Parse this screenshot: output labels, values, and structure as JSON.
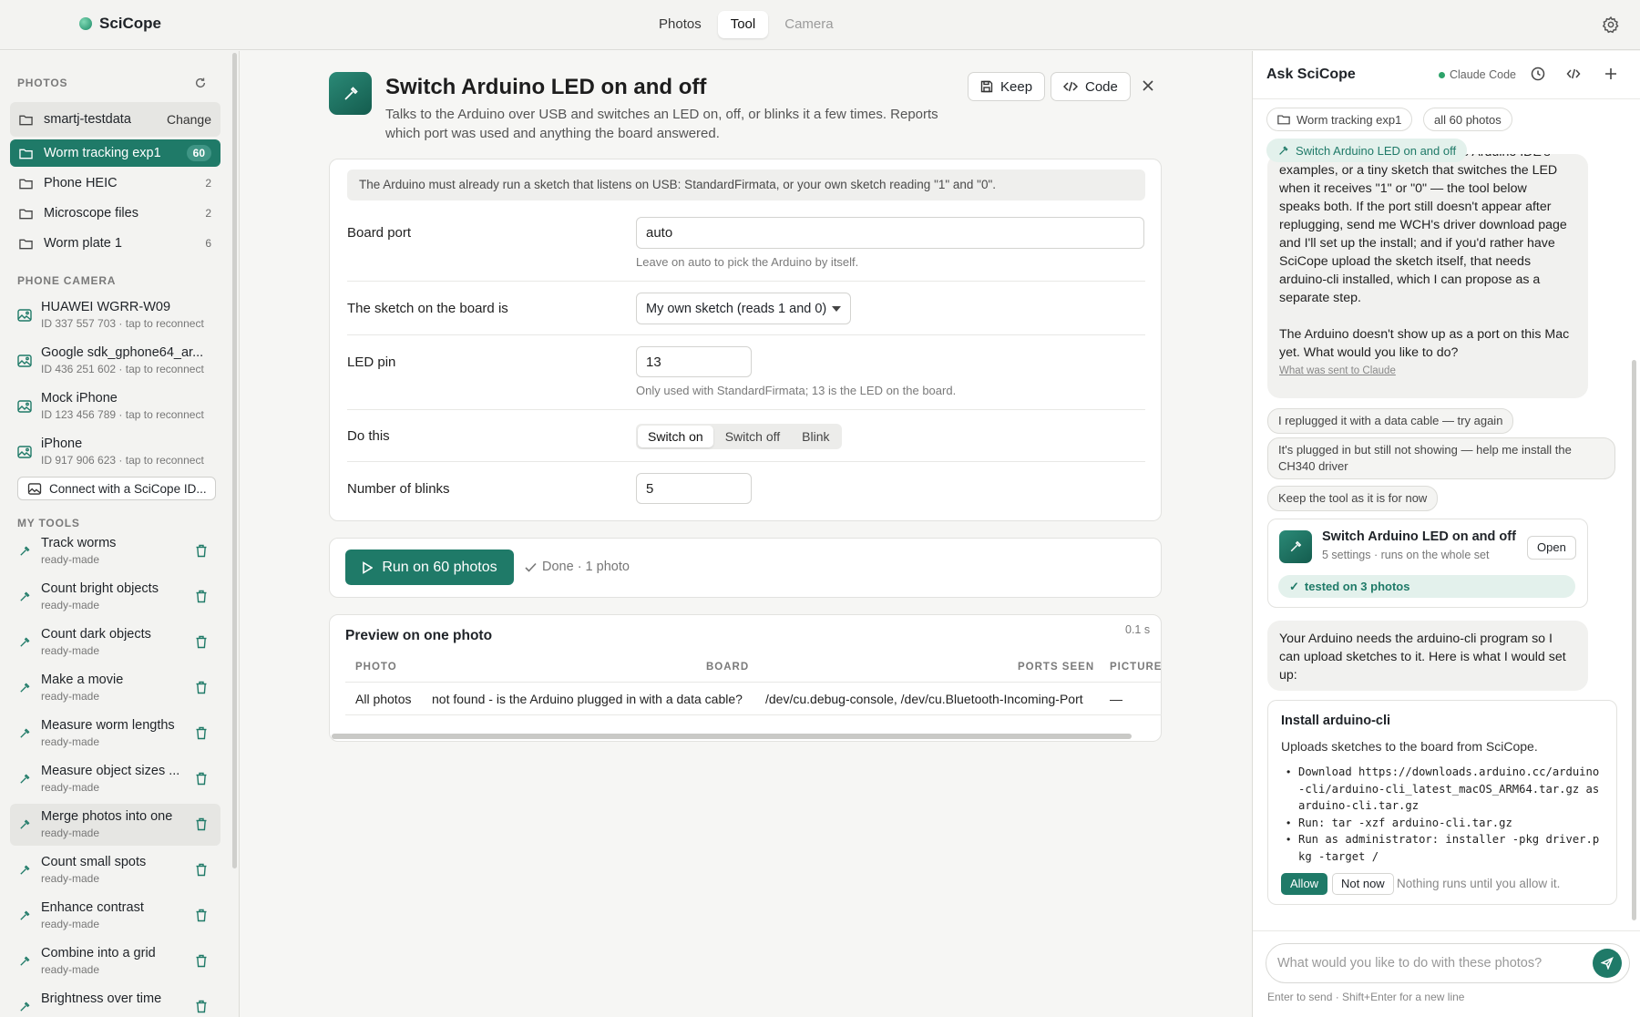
{
  "app": {
    "name": "SciCope"
  },
  "nav": {
    "tabs": [
      {
        "label": "Photos"
      },
      {
        "label": "Tool"
      },
      {
        "label": "Camera"
      }
    ]
  },
  "sidebar": {
    "photos_heading": "PHOTOS",
    "storage": {
      "name": "smartj-testdata",
      "action": "Change"
    },
    "folders": [
      {
        "name": "Worm tracking exp1",
        "count": "60"
      },
      {
        "name": "Phone HEIC",
        "count": "2"
      },
      {
        "name": "Microscope files",
        "count": "2"
      },
      {
        "name": "Worm plate 1",
        "count": "6"
      }
    ],
    "camera_heading": "PHONE CAMERA",
    "cameras": [
      {
        "name": "HUAWEI WGRR-W09",
        "sub": "ID 337 557 703 · tap to reconnect"
      },
      {
        "name": "Google sdk_gphone64_ar...",
        "sub": "ID 436 251 602 · tap to reconnect"
      },
      {
        "name": "Mock iPhone",
        "sub": "ID 123 456 789 · tap to reconnect"
      },
      {
        "name": "iPhone",
        "sub": "ID 917 906 623 · tap to reconnect"
      }
    ],
    "connect_label": "Connect with a SciCope ID...",
    "tools_heading": "MY TOOLS",
    "tools": [
      {
        "name": "Track worms",
        "sub": "ready-made"
      },
      {
        "name": "Count bright objects",
        "sub": "ready-made"
      },
      {
        "name": "Count dark objects",
        "sub": "ready-made"
      },
      {
        "name": "Make a movie",
        "sub": "ready-made"
      },
      {
        "name": "Measure worm lengths",
        "sub": "ready-made"
      },
      {
        "name": "Measure object sizes ...",
        "sub": "ready-made"
      },
      {
        "name": "Merge photos into one",
        "sub": "ready-made"
      },
      {
        "name": "Count small spots",
        "sub": "ready-made"
      },
      {
        "name": "Enhance contrast",
        "sub": "ready-made"
      },
      {
        "name": "Combine into a grid",
        "sub": "ready-made"
      },
      {
        "name": "Brightness over time",
        "sub": ""
      }
    ]
  },
  "tool": {
    "title": "Switch Arduino LED on and off",
    "description": "Talks to the Arduino over USB and switches an LED on, off, or blinks it a few times. Reports which port was used and anything the board answered.",
    "keep_label": "Keep",
    "code_label": "Code",
    "notice": "The Arduino must already run a sketch that listens on USB: StandardFirmata, or your own sketch reading \"1\" and \"0\".",
    "fields": {
      "port_label": "Board port",
      "port_value": "auto",
      "port_hint": "Leave on auto to pick the Arduino by itself.",
      "sketch_label": "The sketch on the board is",
      "sketch_value": "My own sketch (reads 1 and 0)",
      "pin_label": "LED pin",
      "pin_value": "13",
      "pin_hint": "Only used with StandardFirmata; 13 is the LED on the board.",
      "action_label": "Do this",
      "action_options": [
        "Switch on",
        "Switch off",
        "Blink"
      ],
      "action_selected": "Switch on",
      "blinks_label": "Number of blinks",
      "blinks_value": "5"
    },
    "run_label": "Run on 60 photos",
    "status": "Done · 1 photo",
    "preview": {
      "title": "Preview on one photo",
      "time": "0.1 s",
      "columns": [
        "PHOTO",
        "BOARD",
        "PORTS SEEN",
        "PICTURES"
      ],
      "row": [
        "All photos",
        "not found - is the Arduino plugged in with a data cable?",
        "/dev/cu.debug-console, /dev/cu.Bluetooth-Incoming-Port",
        "—"
      ]
    }
  },
  "assistant": {
    "title": "Ask SciCope",
    "status": "Claude Code",
    "context_chips": [
      "Worm tracking exp1",
      "all 60 photos"
    ],
    "tool_chip": "Switch Arduino LED on and off",
    "message1_lines": [
      "upload StandardFirmata from the Arduino IDE's",
      "examples, or a tiny sketch that switches the LED",
      "when it receives \"1\" or \"0\" — the tool below",
      "speaks both. If the port still doesn't appear after",
      "replugging, send me WCH's driver download page",
      "and I'll set up the install; and if you'd rather have",
      "SciCope upload the sketch itself, that needs",
      "arduino-cli installed, which I can propose as a",
      "separate step."
    ],
    "message1_end": "The Arduino doesn't show up as a port on this Mac yet. What would you like to do?",
    "message1_link": "What was sent to Claude",
    "suggestions": [
      "I replugged it with a data cable — try again",
      "It's plugged in but still not showing — help me install the CH340 driver",
      "Keep the tool as it is for now"
    ],
    "tool_card": {
      "name": "Switch Arduino LED on and off",
      "sub": "5 settings · runs on the whole set",
      "open_label": "Open",
      "tested": "tested on 3 photos"
    },
    "message2": "Your Arduino needs the arduino-cli program so I can upload sketches to it. Here is what I would set up:",
    "install": {
      "title": "Install arduino-cli",
      "subtitle": "Uploads sketches to the board from SciCope.",
      "steps": [
        "Download https://downloads.arduino.cc/arduino-cli/arduino-cli_latest_macOS_ARM64.tar.gz as arduino-cli.tar.gz",
        "Run: tar -xzf arduino-cli.tar.gz",
        "Run as administrator: installer -pkg driver.pkg -target /"
      ],
      "allow_label": "Allow",
      "notnow_label": "Not now",
      "note": "Nothing runs until you allow it."
    },
    "composer_placeholder": "What would you like to do with these photos?",
    "composer_hint": "Enter to send · Shift+Enter for a new line"
  },
  "colors": {
    "accent": "#1f7a68",
    "accent_soft": "#e3f1ec",
    "status_green": "#2da36a"
  }
}
